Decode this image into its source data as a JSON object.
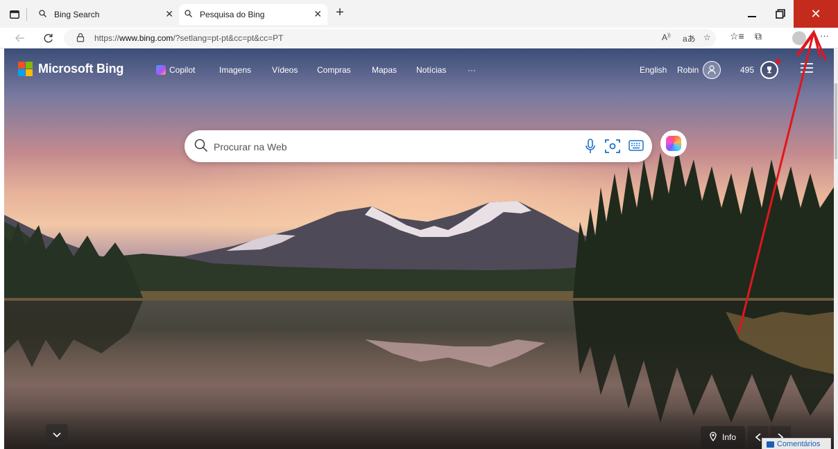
{
  "browser": {
    "tabs": [
      {
        "title": "Bing Search",
        "icon": "search-icon",
        "active": false
      },
      {
        "title": "Pesquisa do Bing",
        "icon": "search-icon",
        "active": true
      }
    ],
    "new_tab_glyph": "+",
    "close_glyph": "✕",
    "url_prefix": "https://",
    "url_host": "www.bing.com",
    "url_rest": "/?setlang=pt-pt&cc=pt&cc=PT",
    "colors": {
      "close_button": "#c42b1c"
    }
  },
  "bing": {
    "brand": "Microsoft Bing",
    "nav": [
      "Copilot",
      "Imagens",
      "Vídeos",
      "Compras",
      "Mapas",
      "Notícias",
      "···"
    ],
    "language_link": "English",
    "user_name": "Robin",
    "rewards_points": "495",
    "search_placeholder": "Procurar na Web",
    "info_label": "Info",
    "feedback_label": "Comentários",
    "logo_colors": [
      "#f25022",
      "#7fba00",
      "#00a4ef",
      "#ffb900"
    ]
  },
  "annotation": {
    "arrow_color": "#e0161e"
  }
}
